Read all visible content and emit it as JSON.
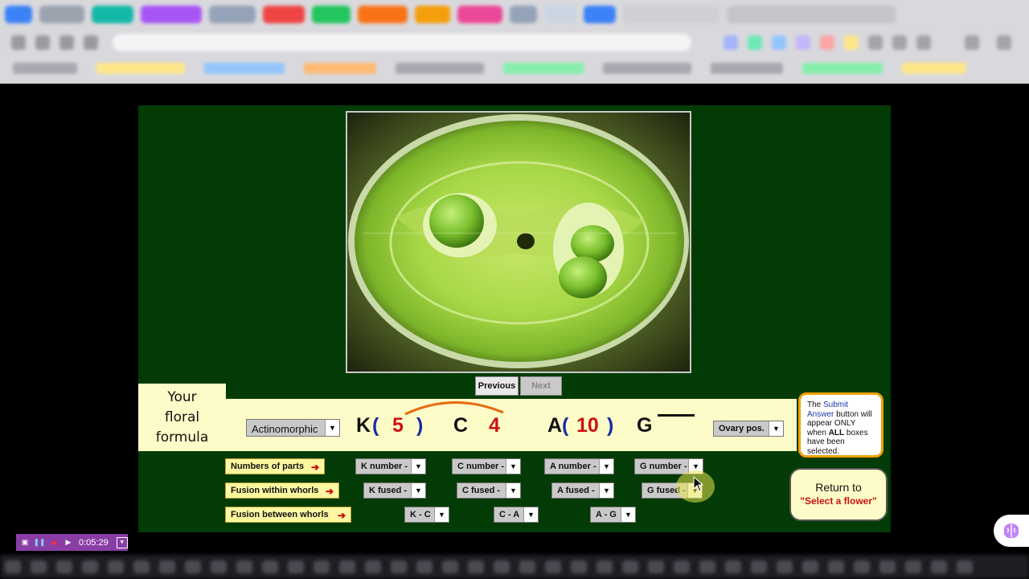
{
  "app": {
    "nav": {
      "previous_label": "Previous",
      "next_label": "Next"
    },
    "formula_label": [
      "Your",
      "floral",
      "formula"
    ],
    "symmetry": {
      "selected": "Actinomorphic"
    },
    "formula": {
      "k_letter": "K",
      "k_open": "(",
      "k_number": "5",
      "k_close": ")",
      "c_letter": "C",
      "c_number": "4",
      "a_letter": "A",
      "a_open": "(",
      "a_number": "10",
      "a_close": ")",
      "g_letter": "G"
    },
    "ovary": {
      "selected": "Ovary pos."
    },
    "rows": {
      "parts": "Numbers of parts",
      "fusion_within": "Fusion within whorls",
      "fusion_between": "Fusion between whorls"
    },
    "selects": {
      "k_number": "K number -",
      "c_number": "C number -",
      "a_number": "A number -",
      "g_number": "G number -",
      "k_fused": "K fused -",
      "c_fused": "C fused -",
      "a_fused": "A fused -",
      "g_fused": "G fused -",
      "k_c": "K - C",
      "c_a": "C - A",
      "a_g": "A - G"
    },
    "info": {
      "t1": "The ",
      "h1": "Submit Answer",
      "t2": " button will appear ONLY when ",
      "h2": "ALL",
      "t3": " boxes have been selected."
    },
    "return_btn": {
      "line1": "Return to",
      "line2": "\"Select a flower\""
    }
  },
  "recorder": {
    "time": "0:05:29"
  },
  "colors": {
    "stage_bg": "#033b06",
    "formula_bg": "#fdfcc8",
    "accent_orange": "#f0a000",
    "red": "#cc1111",
    "blue": "#1a2aa8"
  }
}
